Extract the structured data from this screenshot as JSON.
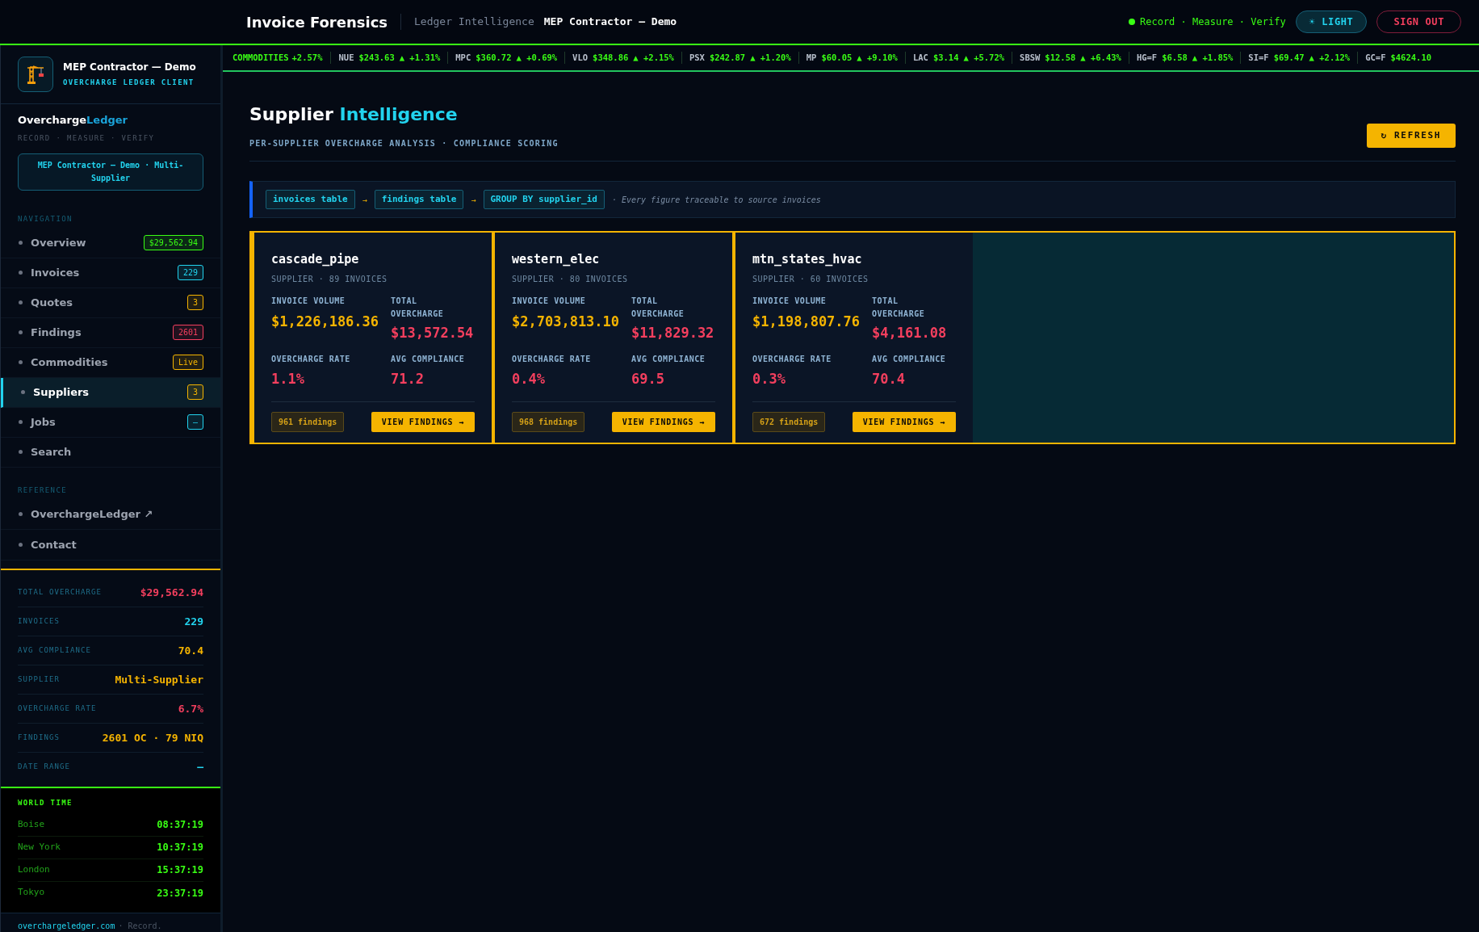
{
  "header": {
    "title": "Invoice Forensics",
    "subtitle": "Ledger Intelligence",
    "client": "MEP Contractor — Demo",
    "status": "Record · Measure · Verify",
    "theme_button": "☀ LIGHT",
    "signout_button": "SIGN OUT"
  },
  "ticker": {
    "label": "COMMODITIES",
    "lead_change": "+2.57%",
    "items": [
      {
        "symbol": "NUE",
        "price": "$243.63",
        "change": "▲ +1.31%"
      },
      {
        "symbol": "MPC",
        "price": "$360.72",
        "change": "▲ +0.69%"
      },
      {
        "symbol": "VLO",
        "price": "$348.86",
        "change": "▲ +2.15%"
      },
      {
        "symbol": "PSX",
        "price": "$242.87",
        "change": "▲ +1.20%"
      },
      {
        "symbol": "MP",
        "price": "$60.05",
        "change": "▲ +9.10%"
      },
      {
        "symbol": "LAC",
        "price": "$3.14",
        "change": "▲ +5.72%"
      },
      {
        "symbol": "SBSW",
        "price": "$12.58",
        "change": "▲ +6.43%"
      },
      {
        "symbol": "HG=F",
        "price": "$6.58",
        "change": "▲ +1.85%"
      },
      {
        "symbol": "SI=F",
        "price": "$69.47",
        "change": "▲ +2.12%"
      },
      {
        "symbol": "GC=F",
        "price": "$4624.10"
      }
    ]
  },
  "sidebar": {
    "client_name": "MEP Contractor — Demo",
    "client_tag": "OVERCHARGE LEDGER CLIENT",
    "brand_a": "Overcharge",
    "brand_b": "Ledger",
    "tagline": "RECORD · MEASURE · VERIFY",
    "scope": "MEP Contractor — Demo · Multi-Supplier",
    "nav_label": "NAVIGATION",
    "nav": [
      {
        "label": "Overview",
        "badge": "$29,562.94",
        "color": "#39ff14",
        "selected": false
      },
      {
        "label": "Invoices",
        "badge": "229",
        "color": "#22d3ee",
        "selected": false
      },
      {
        "label": "Quotes",
        "badge": "3",
        "color": "#f5b400",
        "selected": false
      },
      {
        "label": "Findings",
        "badge": "2601",
        "color": "#f43f5e",
        "selected": false
      },
      {
        "label": "Commodities",
        "badge": "Live",
        "color": "#f5b400",
        "selected": false
      },
      {
        "label": "Suppliers",
        "badge": "3",
        "color": "#f5b400",
        "selected": true
      },
      {
        "label": "Jobs",
        "badge": "–",
        "color": "#22d3ee",
        "selected": false
      },
      {
        "label": "Search",
        "selected": false
      }
    ],
    "reference_label": "REFERENCE",
    "reference": [
      {
        "label": "OverchargeLedger ↗"
      },
      {
        "label": "Contact"
      }
    ],
    "stats": [
      {
        "label": "TOTAL OVERCHARGE",
        "value": "$29,562.94",
        "color": "#f43f5e"
      },
      {
        "label": "INVOICES",
        "value": "229",
        "color": "#22d3ee"
      },
      {
        "label": "AVG COMPLIANCE",
        "value": "70.4",
        "color": "#f5b400"
      },
      {
        "label": "SUPPLIER",
        "value": "Multi-Supplier",
        "color": "#f5b400"
      },
      {
        "label": "OVERCHARGE RATE",
        "value": "6.7%",
        "color": "#f43f5e"
      },
      {
        "label": "FINDINGS",
        "value": "2601 OC · 79 NIQ",
        "color": "#f5b400"
      },
      {
        "label": "DATE RANGE",
        "value": "—",
        "color": "#22d3ee"
      }
    ],
    "world_time_label": "WORLD TIME",
    "world_time": [
      {
        "city": "Boise",
        "time": "08:37:19"
      },
      {
        "city": "New York",
        "time": "10:37:19"
      },
      {
        "city": "London",
        "time": "15:37:19"
      },
      {
        "city": "Tokyo",
        "time": "23:37:19"
      }
    ],
    "footer_link": "overchargeledger.com",
    "footer_text": "· Record."
  },
  "page": {
    "title_a": "Supplier",
    "title_b": "Intelligence",
    "subtitle": "PER-SUPPLIER OVERCHARGE ANALYSIS · COMPLIANCE SCORING",
    "refresh_button": "↻ REFRESH",
    "lineage": [
      "invoices table",
      "findings table",
      "GROUP BY supplier_id"
    ],
    "lineage_arrow": "→",
    "lineage_note": "· Every figure traceable to source invoices",
    "suppliers": [
      {
        "name": "cascade_pipe",
        "meta": "SUPPLIER · 89 INVOICES",
        "labels": {
          "volume": "INVOICE VOLUME",
          "overcharge": "TOTAL OVERCHARGE",
          "rate": "OVERCHARGE RATE",
          "compliance": "AVG COMPLIANCE"
        },
        "volume": "$1,226,186.36",
        "overcharge": "$13,572.54",
        "rate": "1.1%",
        "compliance": "71.2",
        "findings": "961 findings",
        "button": "VIEW FINDINGS →"
      },
      {
        "name": "western_elec",
        "meta": "SUPPLIER · 80 INVOICES",
        "labels": {
          "volume": "INVOICE VOLUME",
          "overcharge": "TOTAL OVERCHARGE",
          "rate": "OVERCHARGE RATE",
          "compliance": "AVG COMPLIANCE"
        },
        "volume": "$2,703,813.10",
        "overcharge": "$11,829.32",
        "rate": "0.4%",
        "compliance": "69.5",
        "findings": "968 findings",
        "button": "VIEW FINDINGS →"
      },
      {
        "name": "mtn_states_hvac",
        "meta": "SUPPLIER · 60 INVOICES",
        "labels": {
          "volume": "INVOICE VOLUME",
          "overcharge": "TOTAL OVERCHARGE",
          "rate": "OVERCHARGE RATE",
          "compliance": "AVG COMPLIANCE"
        },
        "volume": "$1,198,807.76",
        "overcharge": "$4,161.08",
        "rate": "0.3%",
        "compliance": "70.4",
        "findings": "672 findings",
        "button": "VIEW FINDINGS →"
      }
    ]
  }
}
